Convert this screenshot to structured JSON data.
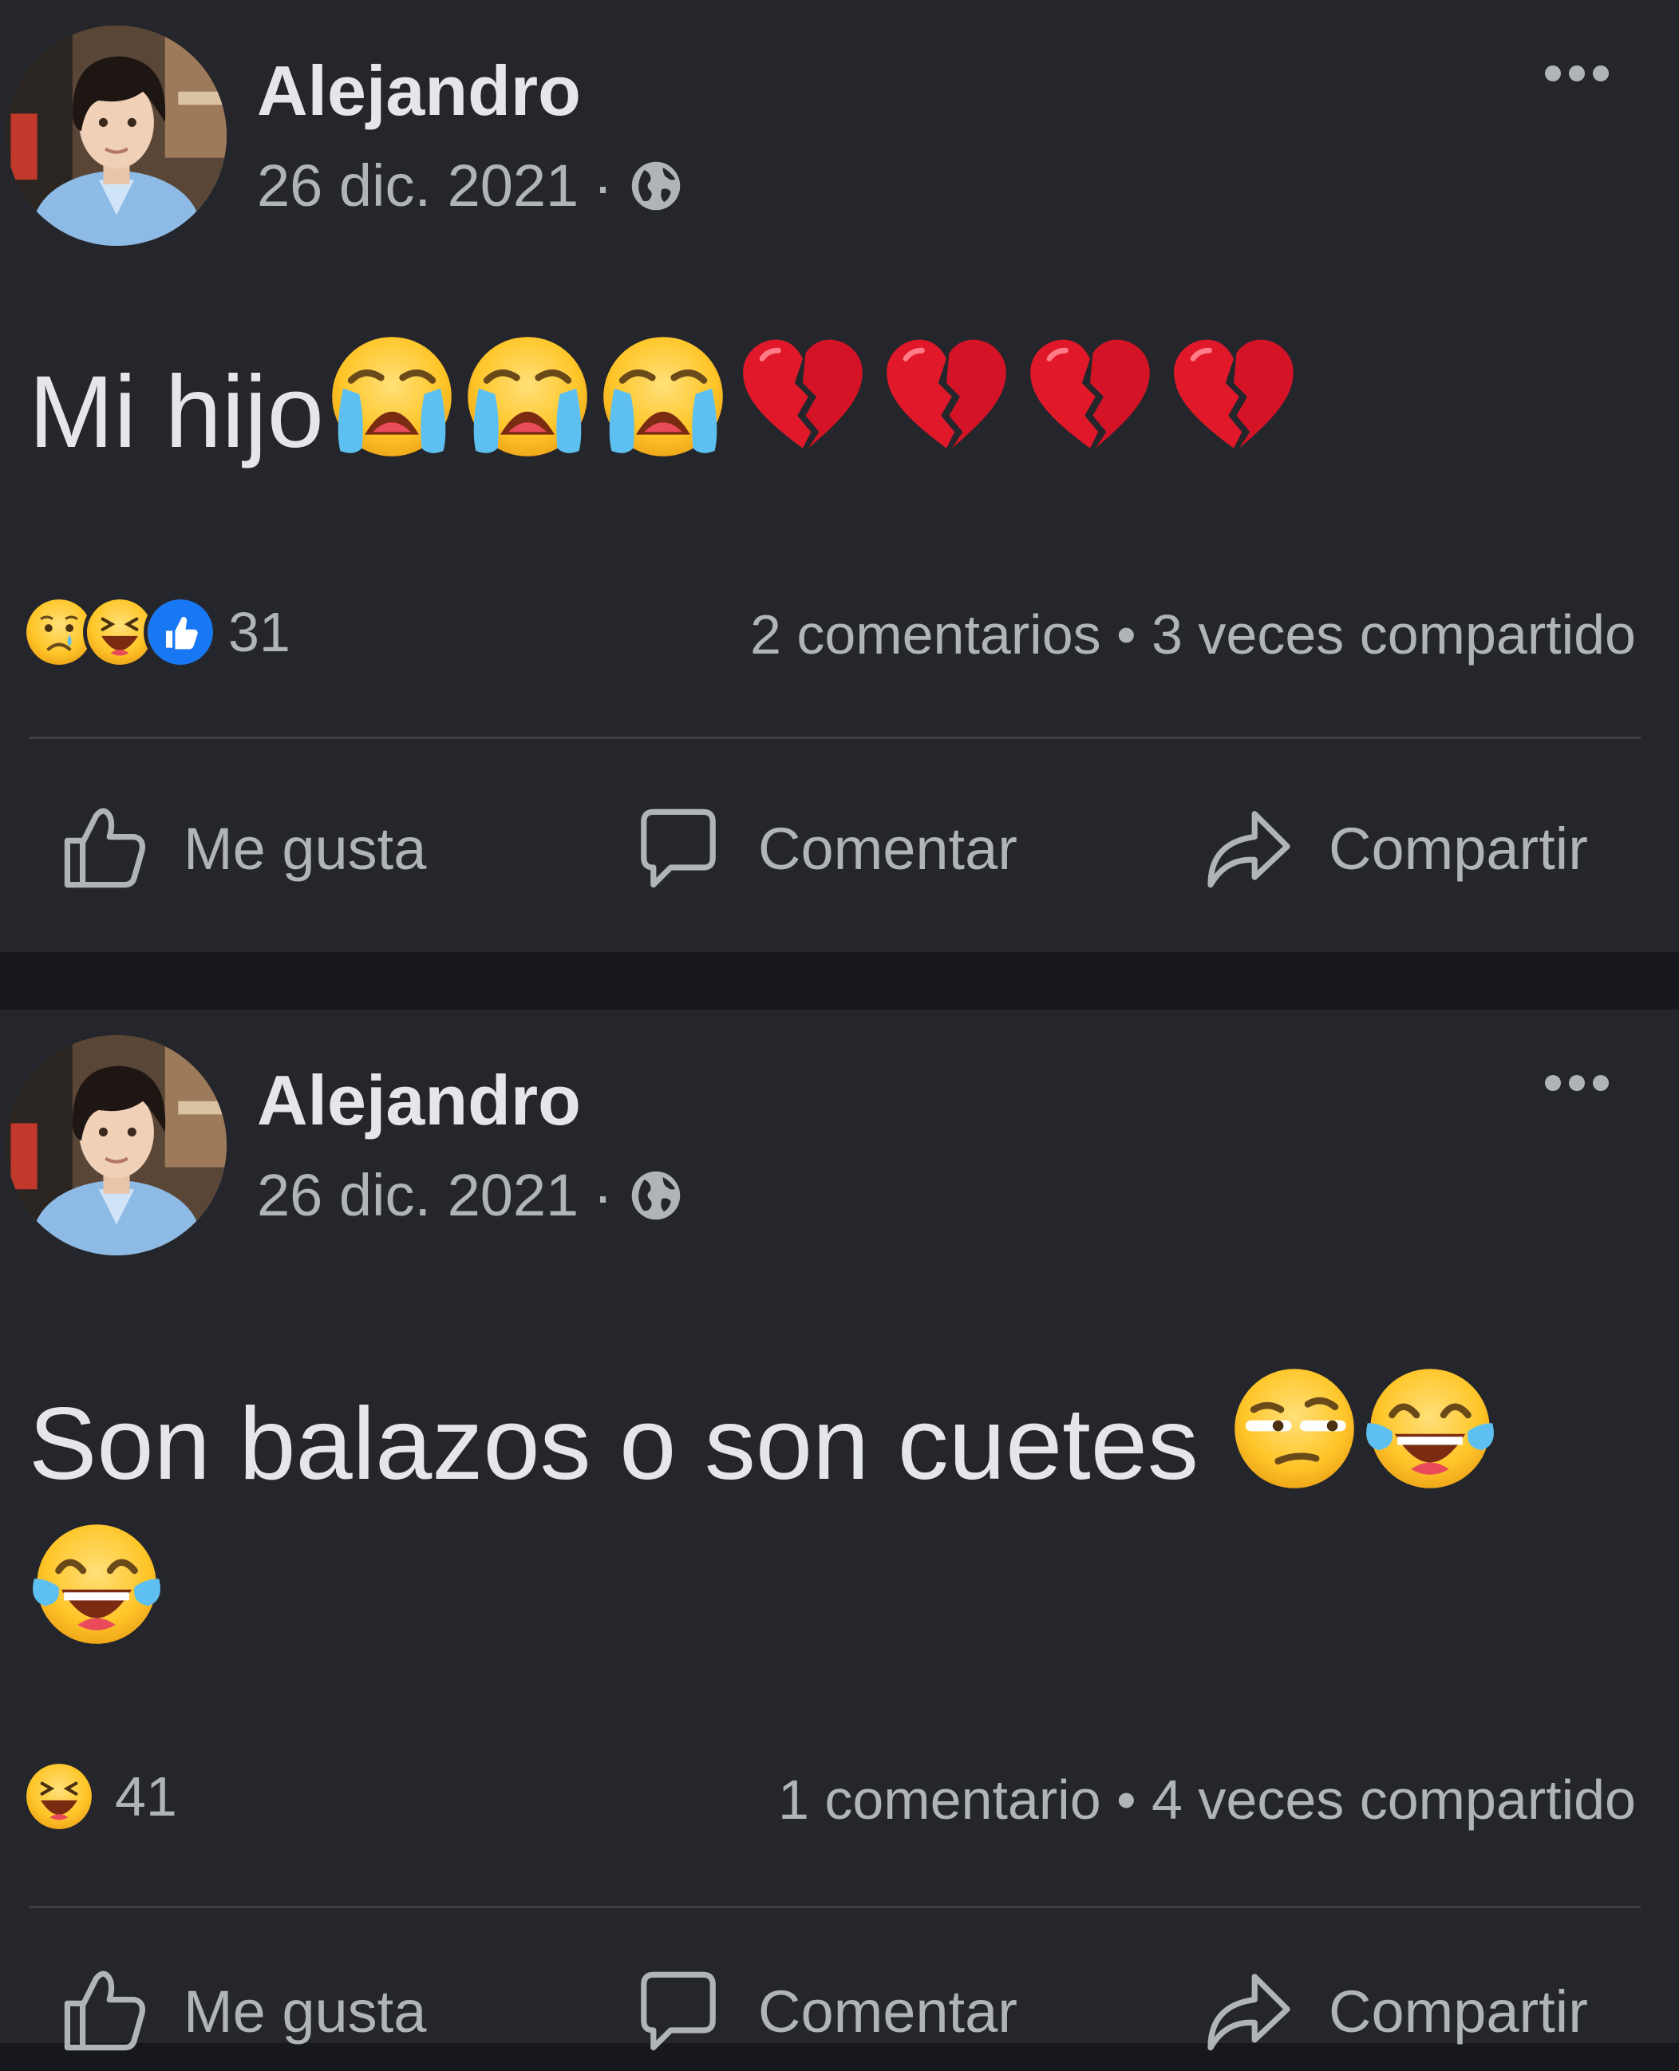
{
  "posts": [
    {
      "author": "Alejandro",
      "date": "26 dic. 2021",
      "separator": "·",
      "text": "Mi hijo",
      "text_emojis": [
        "crying-face",
        "crying-face",
        "crying-face",
        "broken-heart",
        "broken-heart",
        "broken-heart",
        "broken-heart"
      ],
      "reactions": [
        "sad",
        "haha",
        "like"
      ],
      "reaction_count": "31",
      "stats": "2 comentarios • 3 veces compartido",
      "actions": {
        "like": "Me gusta",
        "comment": "Comentar",
        "share": "Compartir"
      }
    },
    {
      "author": "Alejandro",
      "date": "26 dic. 2021",
      "separator": "·",
      "text": "Son balazos o son cuetes",
      "text_emojis": [
        "unamused-face",
        "tears-of-joy",
        "tears-of-joy"
      ],
      "reactions": [
        "haha"
      ],
      "reaction_count": "41",
      "stats": "1 comentario • 4 veces compartido",
      "actions": {
        "like": "Me gusta",
        "comment": "Comentar",
        "share": "Compartir"
      }
    }
  ],
  "colors": {
    "background": "#17181b",
    "card": "#25262b",
    "text_primary": "#e4e6eb",
    "text_secondary": "#b0b3b8",
    "like_blue": "#1877f2",
    "emoji_yellow": "#ffcc33",
    "heart_red": "#e0182a"
  }
}
